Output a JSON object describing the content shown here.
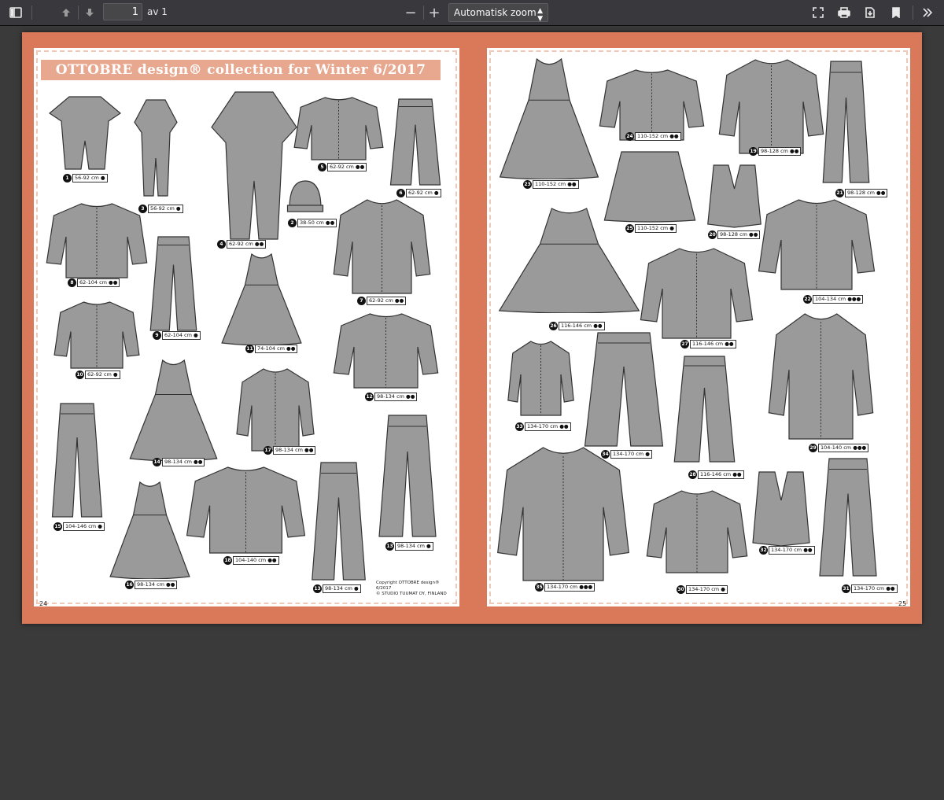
{
  "toolbar": {
    "page_current": "1",
    "page_of": "av 1",
    "zoom_minus": "−",
    "zoom_plus": "+",
    "zoom_value": "Automatisk zoom"
  },
  "icons": [
    "sidebar-toggle-icon",
    "previous-page-icon",
    "next-page-icon",
    "fullscreen-icon",
    "print-icon",
    "download-icon",
    "bookmark-icon",
    "more-tools-icon"
  ],
  "document": {
    "title": "OTTOBRE design® collection for Winter 6/2017",
    "copyright_line1": "Copyright OTTOBRE design® 6/2017",
    "copyright_line2": "© STUDIO TUUMAT OY, FINLAND",
    "folio_left": "24",
    "folio_right": "25",
    "accent_color": "#d9795a",
    "items": [
      {
        "num": "1",
        "size": "56-92 cm ●"
      },
      {
        "num": "2",
        "size": "38-50 cm ●●"
      },
      {
        "num": "3",
        "size": "56-92 cm ●"
      },
      {
        "num": "4",
        "size": "62-92 cm ●●"
      },
      {
        "num": "5",
        "size": "62-92 cm ●●"
      },
      {
        "num": "6",
        "size": "62-92 cm ●"
      },
      {
        "num": "7",
        "size": "62-92 cm ●●"
      },
      {
        "num": "8",
        "size": "62-104 cm ●●"
      },
      {
        "num": "9",
        "size": "62-104 cm ●"
      },
      {
        "num": "10",
        "size": "62-92 cm ●"
      },
      {
        "num": "11",
        "size": "74-104 cm ●●"
      },
      {
        "num": "12",
        "size": "98-134 cm ●●"
      },
      {
        "num": "13",
        "size": "98-134 cm ●"
      },
      {
        "num": "13",
        "size": "98-134 cm ●"
      },
      {
        "num": "14",
        "size": "98-134 cm ●●"
      },
      {
        "num": "15",
        "size": "104-146 cm ●"
      },
      {
        "num": "16",
        "size": "98-134 cm ●●"
      },
      {
        "num": "17",
        "size": "98-134 cm ●●"
      },
      {
        "num": "18",
        "size": "104-140 cm ●●"
      },
      {
        "num": "19",
        "size": "98-128 cm ●●"
      },
      {
        "num": "20",
        "size": "98-128 cm ●●"
      },
      {
        "num": "21",
        "size": "98-128 cm ●●"
      },
      {
        "num": "22",
        "size": "104-134 cm ●●●"
      },
      {
        "num": "23",
        "size": "110-152 cm ●●"
      },
      {
        "num": "24",
        "size": "110-152 cm ●●"
      },
      {
        "num": "25",
        "size": "110-152 cm ●"
      },
      {
        "num": "26",
        "size": "116-146 cm ●●"
      },
      {
        "num": "27",
        "size": "116-146 cm ●●"
      },
      {
        "num": "28",
        "size": "116-146 cm ●●"
      },
      {
        "num": "29",
        "size": "104-140 cm ●●●"
      },
      {
        "num": "30",
        "size": "134-170 cm ●"
      },
      {
        "num": "31",
        "size": "134-170 cm ●●"
      },
      {
        "num": "32",
        "size": "134-170 cm ●●"
      },
      {
        "num": "33",
        "size": "134-170 cm ●●"
      },
      {
        "num": "34",
        "size": "134-170 cm ●"
      },
      {
        "num": "35",
        "size": "134-170 cm ●●●"
      }
    ]
  }
}
